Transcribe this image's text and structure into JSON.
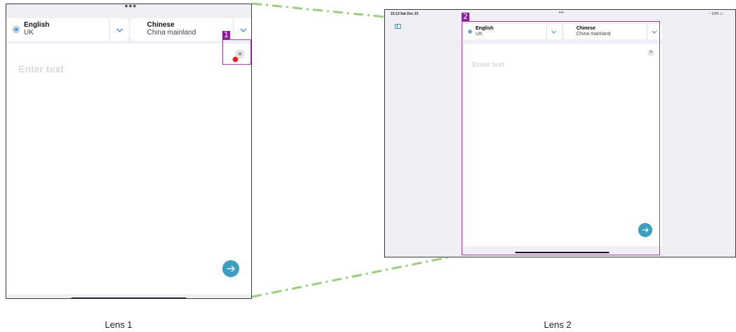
{
  "lens1": {
    "caption": "Lens 1",
    "box_label": "1",
    "top_dots": "•••",
    "source_lang": {
      "name": "English",
      "region": "UK"
    },
    "target_lang": {
      "name": "Chinese",
      "region": "China mainland"
    },
    "clear_symbol": "×",
    "placeholder": "Enter text"
  },
  "lens2": {
    "caption": "Lens 2",
    "box_label": "2",
    "status": {
      "time": "15:13  Sat Dec 23",
      "dots": "•••",
      "battery": "12%"
    },
    "source_lang": {
      "name": "English",
      "region": "UK"
    },
    "target_lang": {
      "name": "Chinese",
      "region": "China mainland"
    },
    "clear_symbol": "×",
    "placeholder": "Enter text"
  },
  "colors": {
    "accent": "#3d9fbf",
    "highlight_box": "#a43bb0",
    "connector": "#9ccc7e",
    "tap_marker": "#e21d1d"
  },
  "icons": [
    "chevron-down-icon",
    "close-icon",
    "arrow-right-icon",
    "sidebar-toggle-icon",
    "wifi-icon",
    "battery-icon",
    "radio-icon"
  ]
}
